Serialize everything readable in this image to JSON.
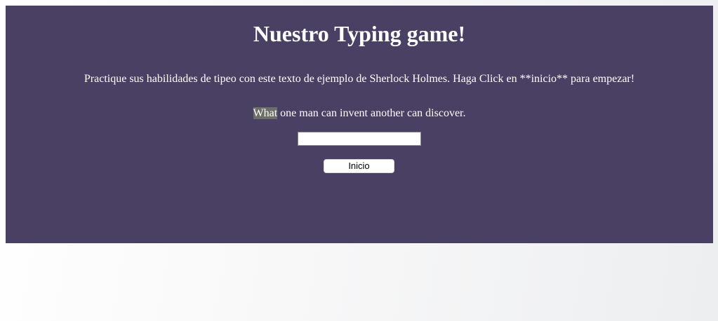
{
  "header": {
    "title": "Nuestro Typing game!"
  },
  "main": {
    "instructions": "Practique sus habilidades de tipeo con este texto de ejemplo de Sherlock Holmes. Haga Click en **inicio** para empezar!",
    "quote": {
      "highlighted_word": "What",
      "rest": " one man can invent another can discover."
    },
    "typed_value": {
      "value": "",
      "placeholder": ""
    },
    "start_button_label": "Inicio"
  },
  "colors": {
    "panel_background": "#4a4064",
    "text": "#ffffff",
    "highlight_background": "#6b6f68"
  }
}
